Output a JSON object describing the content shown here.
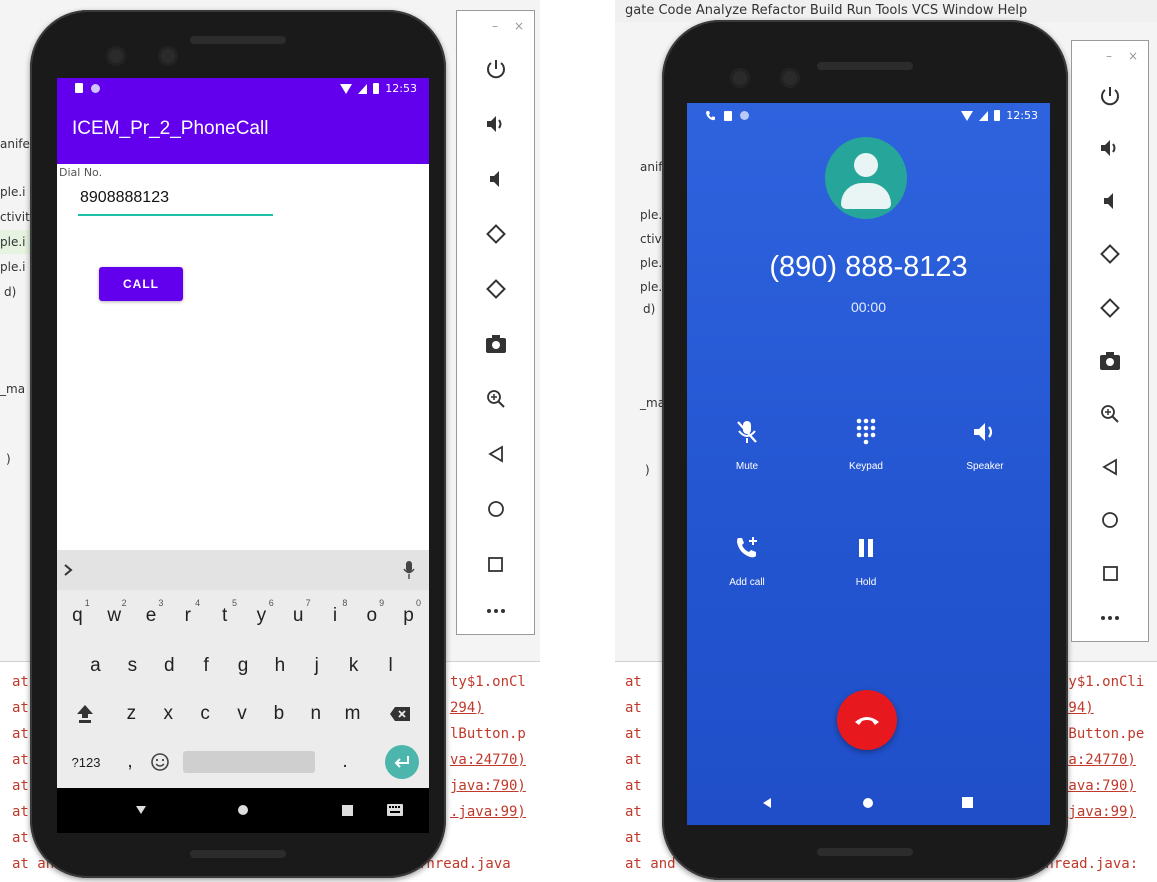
{
  "left_ide": {
    "fragments": [
      "anife",
      "ple.i",
      "ctivit",
      "ple.i",
      "ple.i",
      "d)",
      "_ma",
      ")"
    ],
    "log_lines": [
      {
        "prefix": "at",
        "suffix": "ty$1.onCl"
      },
      {
        "prefix": "at",
        "suffix": "294)"
      },
      {
        "prefix": "at",
        "suffix": "lButton.p"
      },
      {
        "prefix": "at",
        "suffix": "va:24770)"
      },
      {
        "prefix": "at",
        "suffix": "java:790)"
      },
      {
        "prefix": "at",
        "suffix": ".java:99)"
      },
      {
        "prefix": "at a",
        "suffix": ""
      },
      {
        "prefix": "at and",
        "suffix": "Thread.java"
      }
    ]
  },
  "right_ide": {
    "menu": "gate  Code  Analyze  Refactor  Build  Run  Tools  VCS  Window  Help",
    "fragments": [
      "anife",
      "ple.i",
      "ctivit",
      "ple.i",
      "ple.i",
      "d)",
      "_ma",
      ")"
    ],
    "log_lines": [
      {
        "prefix": "at",
        "suffix": "ty$1.onCli"
      },
      {
        "prefix": "at",
        "suffix": "294)"
      },
      {
        "prefix": "at",
        "suffix": "lButton.pe"
      },
      {
        "prefix": "at",
        "suffix": "va:24770)"
      },
      {
        "prefix": "at",
        "suffix": "java:790)"
      },
      {
        "prefix": "at",
        "suffix": ".java:99)"
      },
      {
        "prefix": "at",
        "suffix": ""
      },
      {
        "prefix": "at and",
        "suffix": "Thread.java:"
      }
    ]
  },
  "phone_left": {
    "status_time": "12:53",
    "app_title": "ICEM_Pr_2_PhoneCall",
    "dial_label": "Dial No.",
    "dial_value": "8908888123",
    "call_button": "CALL",
    "keyboard": {
      "row1": [
        [
          "q",
          "1"
        ],
        [
          "w",
          "2"
        ],
        [
          "e",
          "3"
        ],
        [
          "r",
          "4"
        ],
        [
          "t",
          "5"
        ],
        [
          "y",
          "6"
        ],
        [
          "u",
          "7"
        ],
        [
          "i",
          "8"
        ],
        [
          "o",
          "9"
        ],
        [
          "p",
          "0"
        ]
      ],
      "row2": [
        "a",
        "s",
        "d",
        "f",
        "g",
        "h",
        "j",
        "k",
        "l"
      ],
      "row3": [
        "z",
        "x",
        "c",
        "v",
        "b",
        "n",
        "m"
      ],
      "sym": "?123",
      "comma": ",",
      "period": "."
    }
  },
  "phone_right": {
    "status_time": "12:53",
    "number": "(890) 888-8123",
    "timer": "00:00",
    "controls": {
      "mute": "Mute",
      "keypad": "Keypad",
      "speaker": "Speaker",
      "add_call": "Add call",
      "hold": "Hold"
    }
  },
  "colors": {
    "app_primary": "#6200ee",
    "input_underline": "#1ec1a8",
    "call_bg": "#2456d2",
    "avatar": "#26a69a",
    "end_call": "#e8191e"
  }
}
